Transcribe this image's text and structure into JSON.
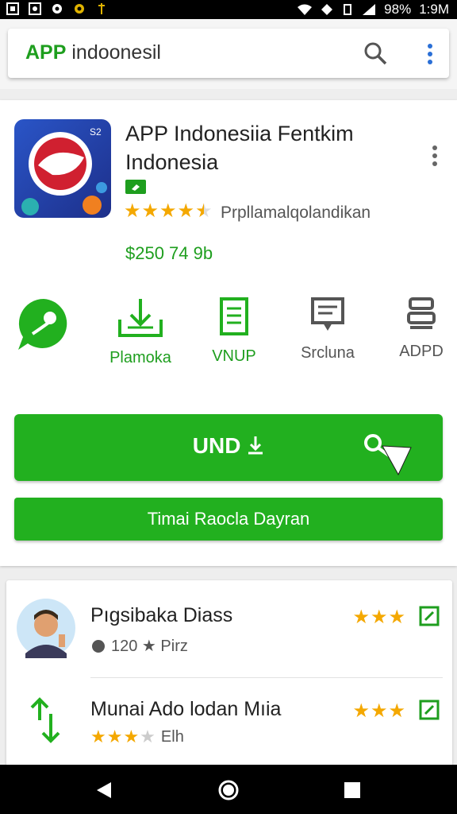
{
  "status_bar": {
    "battery": "98%",
    "time": "1:9M"
  },
  "search": {
    "brand": "APP",
    "query": "indoonesil"
  },
  "app": {
    "title": "APP Indonesiia Fentkim Indonesia",
    "rating": 4.5,
    "developer": "Prpllamalqolandikan",
    "price": "$250 74 9b"
  },
  "actions": [
    {
      "label": "",
      "icon": "chat-bubble-icon"
    },
    {
      "label": "Plamoka",
      "icon": "download-tray-icon"
    },
    {
      "label": "VNUP",
      "icon": "document-icon"
    },
    {
      "label": "Srcluna",
      "icon": "message-board-icon"
    },
    {
      "label": "ADPD",
      "icon": "server-icon"
    }
  ],
  "buttons": {
    "primary": "UND",
    "secondary": "Timai Raocla Dayran"
  },
  "list": [
    {
      "title": "Pıgsibaka Diass",
      "sub": "120 ★ Pirz",
      "stars": "★★★"
    },
    {
      "title": "Munai Ado lodan Mıia",
      "sub": "Elh",
      "stars": "★★★",
      "sub_rating": 3
    }
  ],
  "colors": {
    "accent": "#22b01f",
    "star": "#f4a800"
  }
}
